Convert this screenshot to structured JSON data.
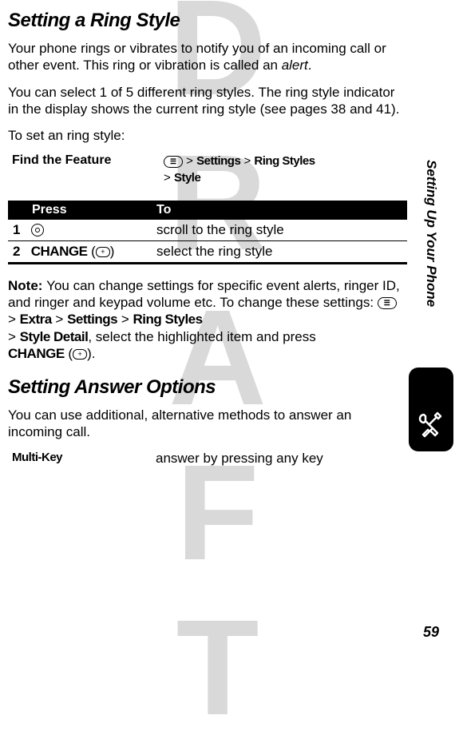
{
  "watermark": "DRAFT",
  "side_tab": "Setting Up Your Phone",
  "page_number": "59",
  "section1": {
    "heading": "Setting a Ring Style",
    "p1_a": "Your phone rings or vibrates to notify you of an incoming call or other event. This ring or vibration is called an ",
    "p1_italic": "alert",
    "p1_b": ".",
    "p2": "You can select 1 of 5 different ring styles. The ring style indicator in the display shows the current ring style (see pages 38 and 41).",
    "p3": "To set an ring style:",
    "feature_label": "Find the Feature",
    "nav_line1_a": " > ",
    "nav_line1_b": "Settings",
    "nav_line1_c": " > ",
    "nav_line1_d": "Ring Styles",
    "nav_line2_a": "> ",
    "nav_line2_b": "Style",
    "table": {
      "h1": "Press",
      "h2": "To",
      "r1_num": "1",
      "r1_to": "scroll to the ring style",
      "r2_num": "2",
      "r2_press": "CHANGE",
      "r2_softkey": "+",
      "r2_to": "select the ring style"
    },
    "note_label": "Note: ",
    "note_a": "You can change settings for specific event alerts, ringer ID, and ringer and keypad volume etc. To change these settings: ",
    "note_path1": "Extra",
    "note_path2": "Settings",
    "note_path3": "Ring Styles",
    "note_path4": "Style Detail",
    "note_b": ", select the highlighted item and press ",
    "note_change": "CHANGE",
    "note_softkey": "+",
    "note_end": ")."
  },
  "section2": {
    "heading": "Setting Answer Options",
    "p1": "You can use additional, alternative methods to answer an incoming call.",
    "opt_label": "Multi-Key",
    "opt_desc": "answer by pressing any key"
  }
}
